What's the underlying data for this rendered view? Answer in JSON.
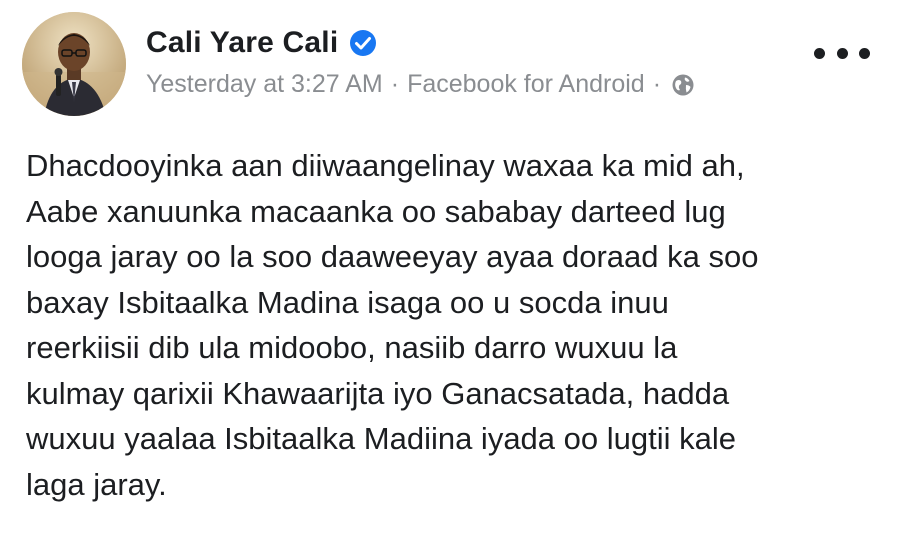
{
  "post": {
    "author": {
      "name": "Cali Yare Cali",
      "verified": true
    },
    "meta": {
      "timestamp": "Yesterday at 3:27 AM",
      "separator": "·",
      "source": "Facebook for Android",
      "privacy_icon": "globe-icon"
    },
    "more_icon": "more-horizontal-icon",
    "body_lines": [
      "Dhacdooyinka aan diiwaangelinay waxaa ka mid ah,",
      "Aabe xanuunka macaanka oo sababay darteed lug",
      "looga jaray oo la soo daaweeyay ayaa doraad ka soo",
      "baxay Isbitaalka Madina isaga oo u socda inuu",
      "reerkiisii dib ula midoobo, nasiib darro wuxuu la",
      "kulmay qarixii Khawaarijta iyo Ganacsatada, hadda",
      "wuxuu yaalaa Isbitaalka Madiina iyada oo lugtii kale",
      "laga jaray."
    ]
  },
  "colors": {
    "text_primary": "#1c1e21",
    "text_secondary": "#8a8d91",
    "verified_blue": "#1877f2"
  }
}
